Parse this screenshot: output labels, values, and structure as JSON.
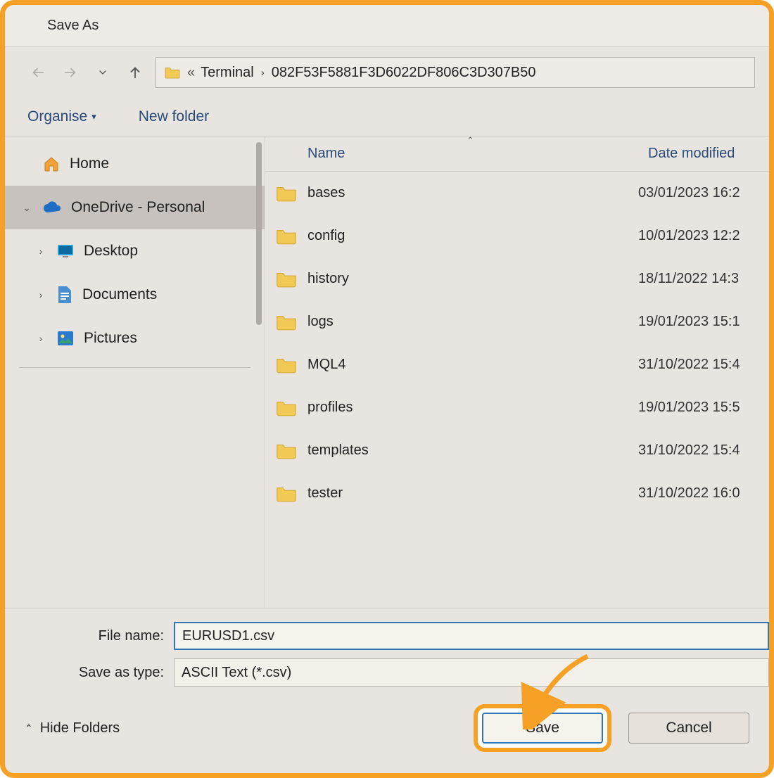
{
  "title": "Save As",
  "breadcrumb": {
    "prefix": "«",
    "part1": "Terminal",
    "sep": "›",
    "part2": "082F53F5881F3D6022DF806C3D307B50"
  },
  "toolbar": {
    "organise": "Organise",
    "newfolder": "New folder"
  },
  "sidebar": {
    "home": "Home",
    "onedrive": "OneDrive - Personal",
    "desktop": "Desktop",
    "documents": "Documents",
    "pictures": "Pictures"
  },
  "columns": {
    "name": "Name",
    "date": "Date modified"
  },
  "files": [
    {
      "name": "bases",
      "date": "03/01/2023 16:2"
    },
    {
      "name": "config",
      "date": "10/01/2023 12:2"
    },
    {
      "name": "history",
      "date": "18/11/2022 14:3"
    },
    {
      "name": "logs",
      "date": "19/01/2023 15:1"
    },
    {
      "name": "MQL4",
      "date": "31/10/2022 15:4"
    },
    {
      "name": "profiles",
      "date": "19/01/2023 15:5"
    },
    {
      "name": "templates",
      "date": "31/10/2022 15:4"
    },
    {
      "name": "tester",
      "date": "31/10/2022 16:0"
    }
  ],
  "form": {
    "filename_label": "File name:",
    "filename_value": "EURUSD1.csv",
    "type_label": "Save as type:",
    "type_value": "ASCII Text (*.csv)"
  },
  "footer": {
    "hide": "Hide Folders",
    "save": "Save",
    "cancel": "Cancel"
  }
}
